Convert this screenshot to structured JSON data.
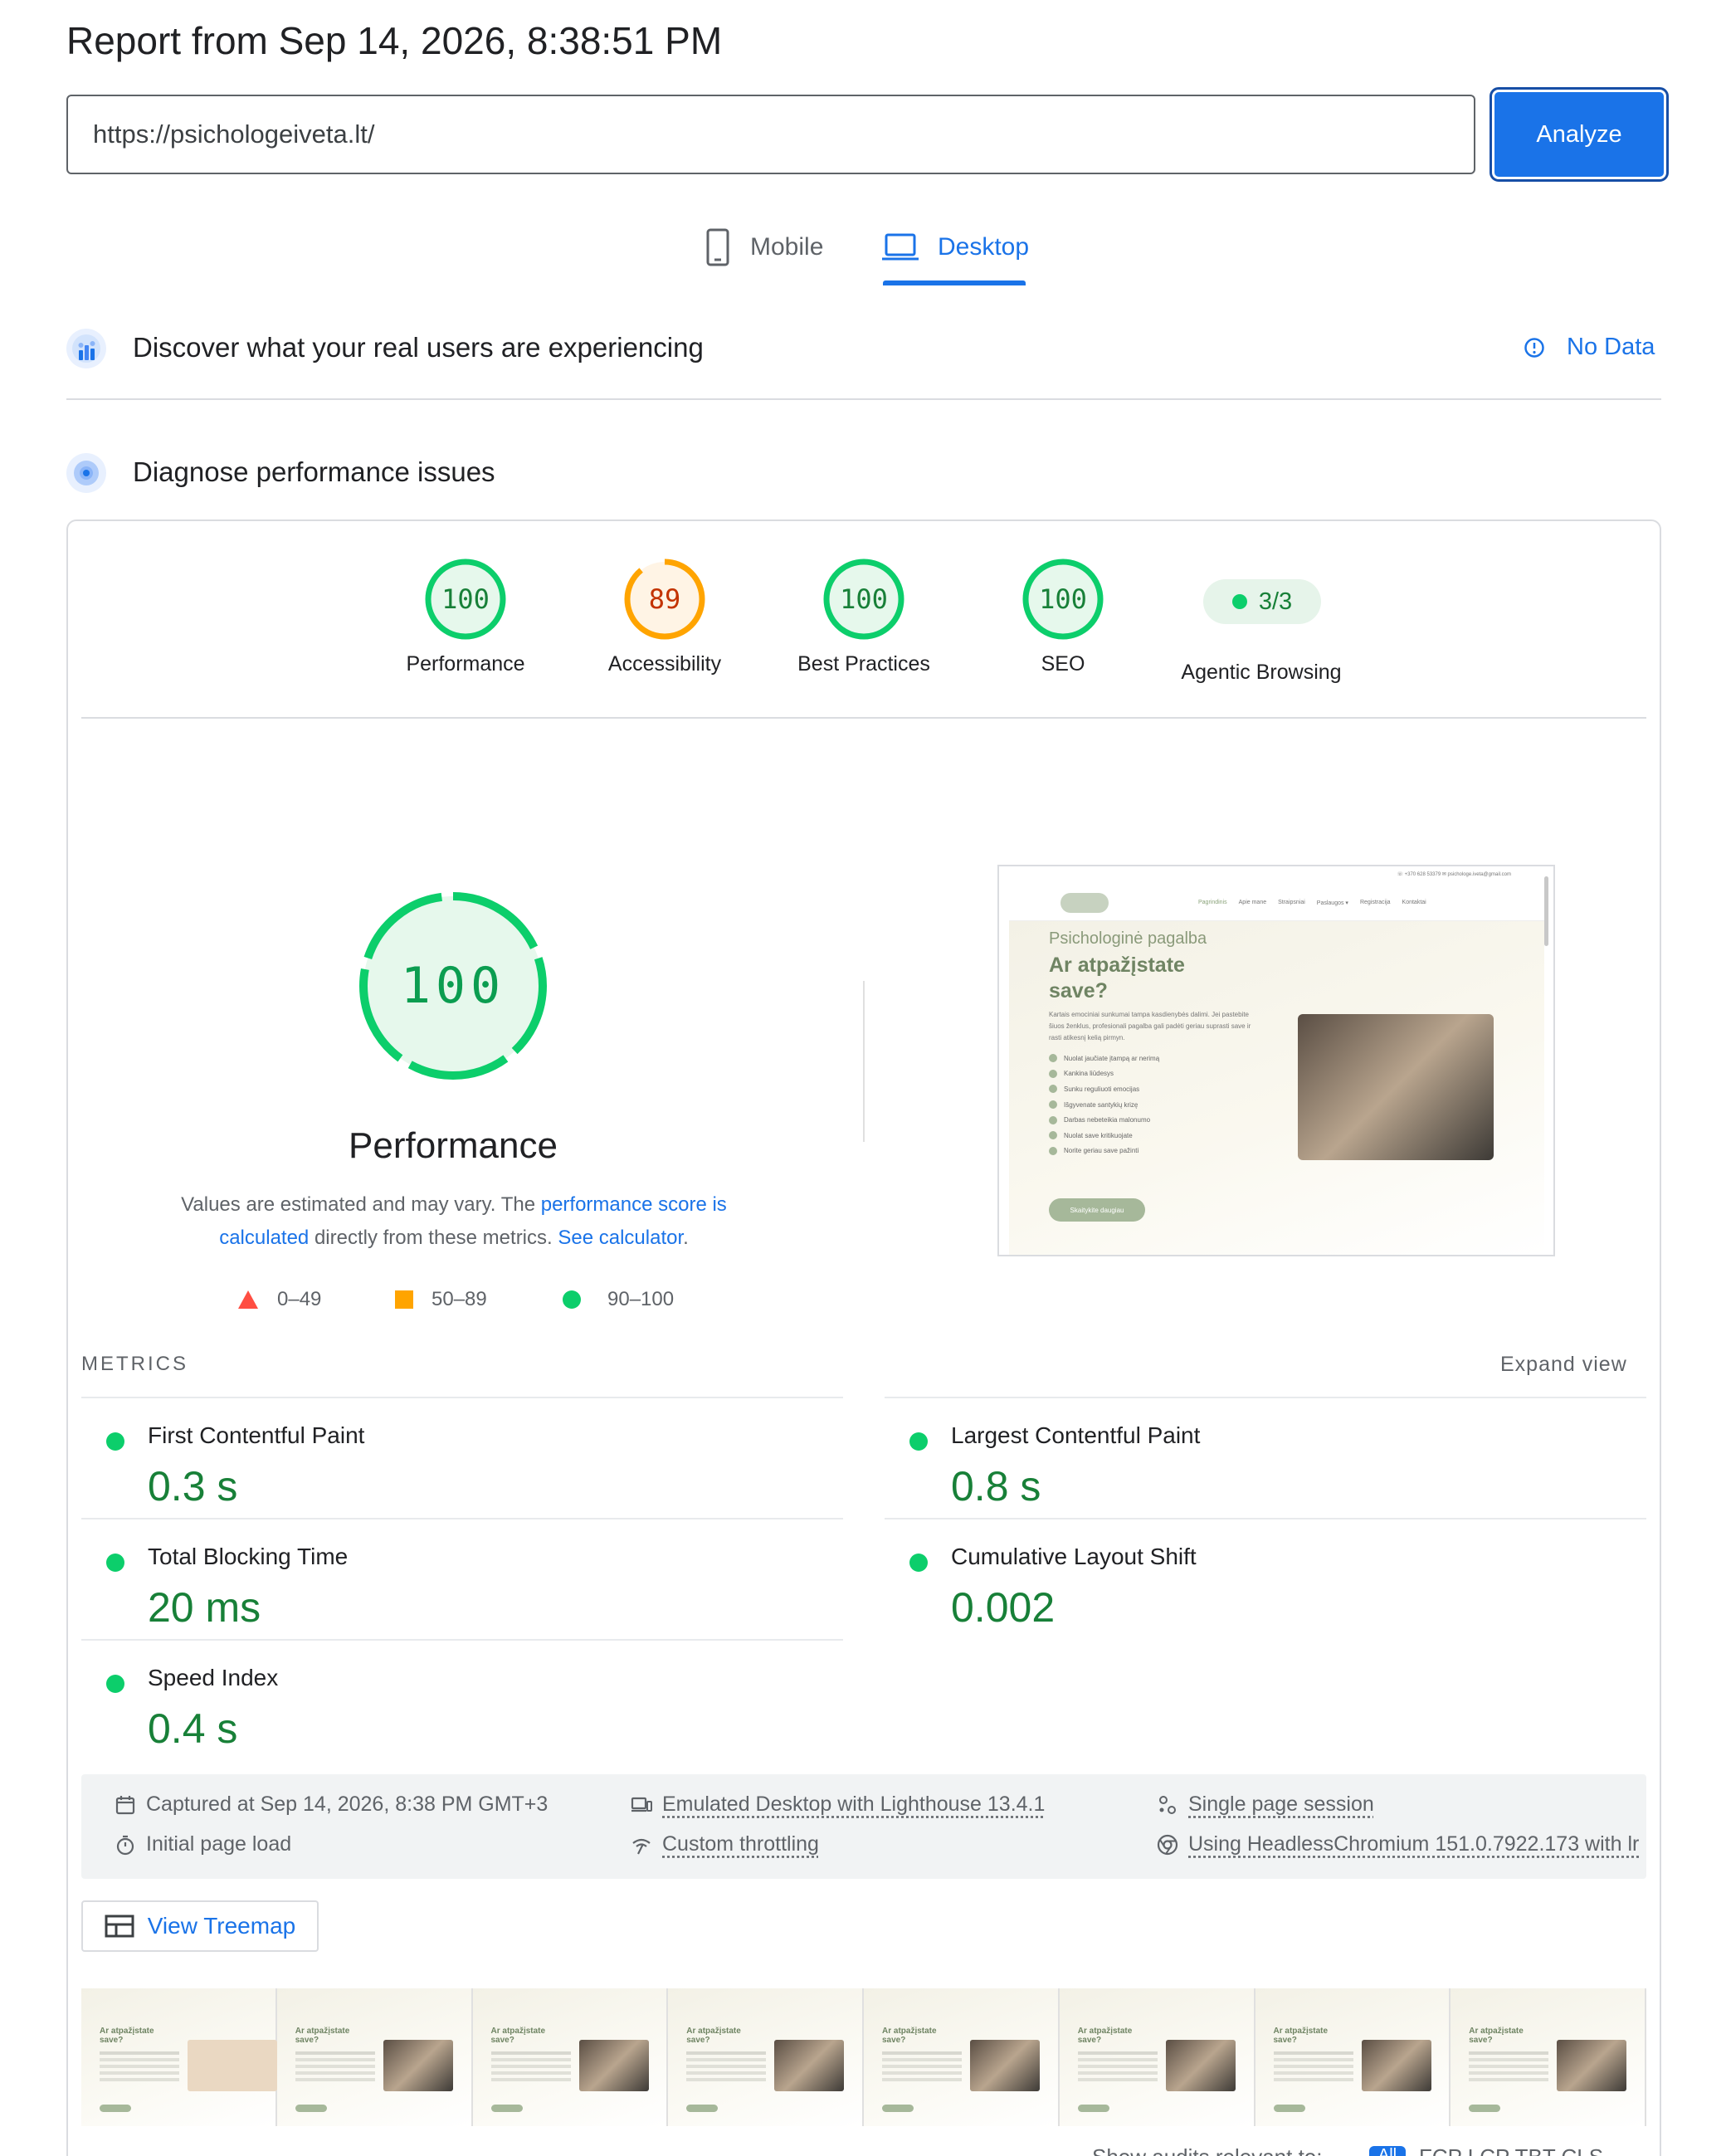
{
  "header": {
    "title": "Report from Sep 14, 2026, 8:38:51 PM",
    "url": "https://psichologeiveta.lt/",
    "analyze_label": "Analyze"
  },
  "tabs": [
    {
      "label": "Mobile",
      "icon": "phone-icon",
      "active": false
    },
    {
      "label": "Desktop",
      "icon": "laptop-icon",
      "active": true
    }
  ],
  "field_section": {
    "title": "Discover what your real users are experiencing",
    "status": "No Data",
    "icon": "users-chart-icon"
  },
  "lab_section": {
    "title": "Diagnose performance issues",
    "icon": "radar-icon"
  },
  "scores": [
    {
      "label": "Performance",
      "value": "100",
      "score": 100,
      "color": "#0cce6b"
    },
    {
      "label": "Accessibility",
      "value": "89",
      "score": 89,
      "color": "#ffa400"
    },
    {
      "label": "Best Practices",
      "value": "100",
      "score": 100,
      "color": "#0cce6b"
    },
    {
      "label": "SEO",
      "value": "100",
      "score": 100,
      "color": "#0cce6b"
    }
  ],
  "agentic": {
    "label": "Agentic Browsing",
    "value": "3/3"
  },
  "performance_detail": {
    "score": "100",
    "title": "Performance",
    "desc_1": "Values are estimated and may vary. The ",
    "link_1": "performance score is calculated",
    "desc_2": " directly from these metrics. ",
    "link_2": "See calculator",
    "desc_3": "."
  },
  "legend": [
    {
      "range": "0–49",
      "shape": "triangle",
      "color": "#ff4e42"
    },
    {
      "range": "50–89",
      "shape": "square",
      "color": "#ffa400"
    },
    {
      "range": "90–100",
      "shape": "circle",
      "color": "#0cce6b"
    }
  ],
  "metrics": {
    "heading": "METRICS",
    "expand": "Expand view",
    "items": [
      {
        "name": "First Contentful Paint",
        "value": "0.3 s"
      },
      {
        "name": "Largest Contentful Paint",
        "value": "0.8 s"
      },
      {
        "name": "Total Blocking Time",
        "value": "20 ms"
      },
      {
        "name": "Cumulative Layout Shift",
        "value": "0.002"
      },
      {
        "name": "Speed Index",
        "value": "0.4 s"
      }
    ]
  },
  "info": {
    "captured": "Captured at Sep 14, 2026, 8:38 PM GMT+3",
    "load": "Initial page load",
    "emulated": "Emulated Desktop with Lighthouse 13.4.1",
    "throttling": "Custom throttling",
    "session": "Single page session",
    "browser": "Using HeadlessChromium 151.0.7922.173 with lr"
  },
  "treemap_label": "View Treemap",
  "screenshot": {
    "topbar": "☏ +370 628 53379   ✉ psichologe.iveta@gmail.com",
    "nav": [
      "Pagrindinis",
      "Apie mane",
      "Straipsniai",
      "Paslaugos ▾",
      "Registracija",
      "Kontaktai"
    ],
    "hero_sub": "Psichologinė pagalba",
    "hero_title_1": "Ar atpažįstate",
    "hero_title_2": "save?",
    "hero_body": "Kartais emociniai sunkumai tampa kasdienybės dalimi. Jei pastebite šiuos ženklus, profesionali pagalba gali padėti geriau suprasti save ir rasti atikesnį kelią pirmyn.",
    "list": [
      "Nuolat jaučiate įtampą ar nerimą",
      "Kankina liūdesys",
      "Sunku reguliuoti emocijas",
      "Išgyvenate santykių krizę",
      "Darbas nebeteikia malonumo",
      "Nuolat save kritikuojate",
      "Norite geriau save pažinti"
    ],
    "cta": "Skaitykite daugiau"
  },
  "filmstrip": {
    "frame_title_1": "Ar atpažįstate",
    "frame_title_2": "save?",
    "count": 8
  },
  "bottom": {
    "text": "Show audits relevant to:",
    "all": "All",
    "filters": "FCP   LCP   TBT   CLS"
  }
}
